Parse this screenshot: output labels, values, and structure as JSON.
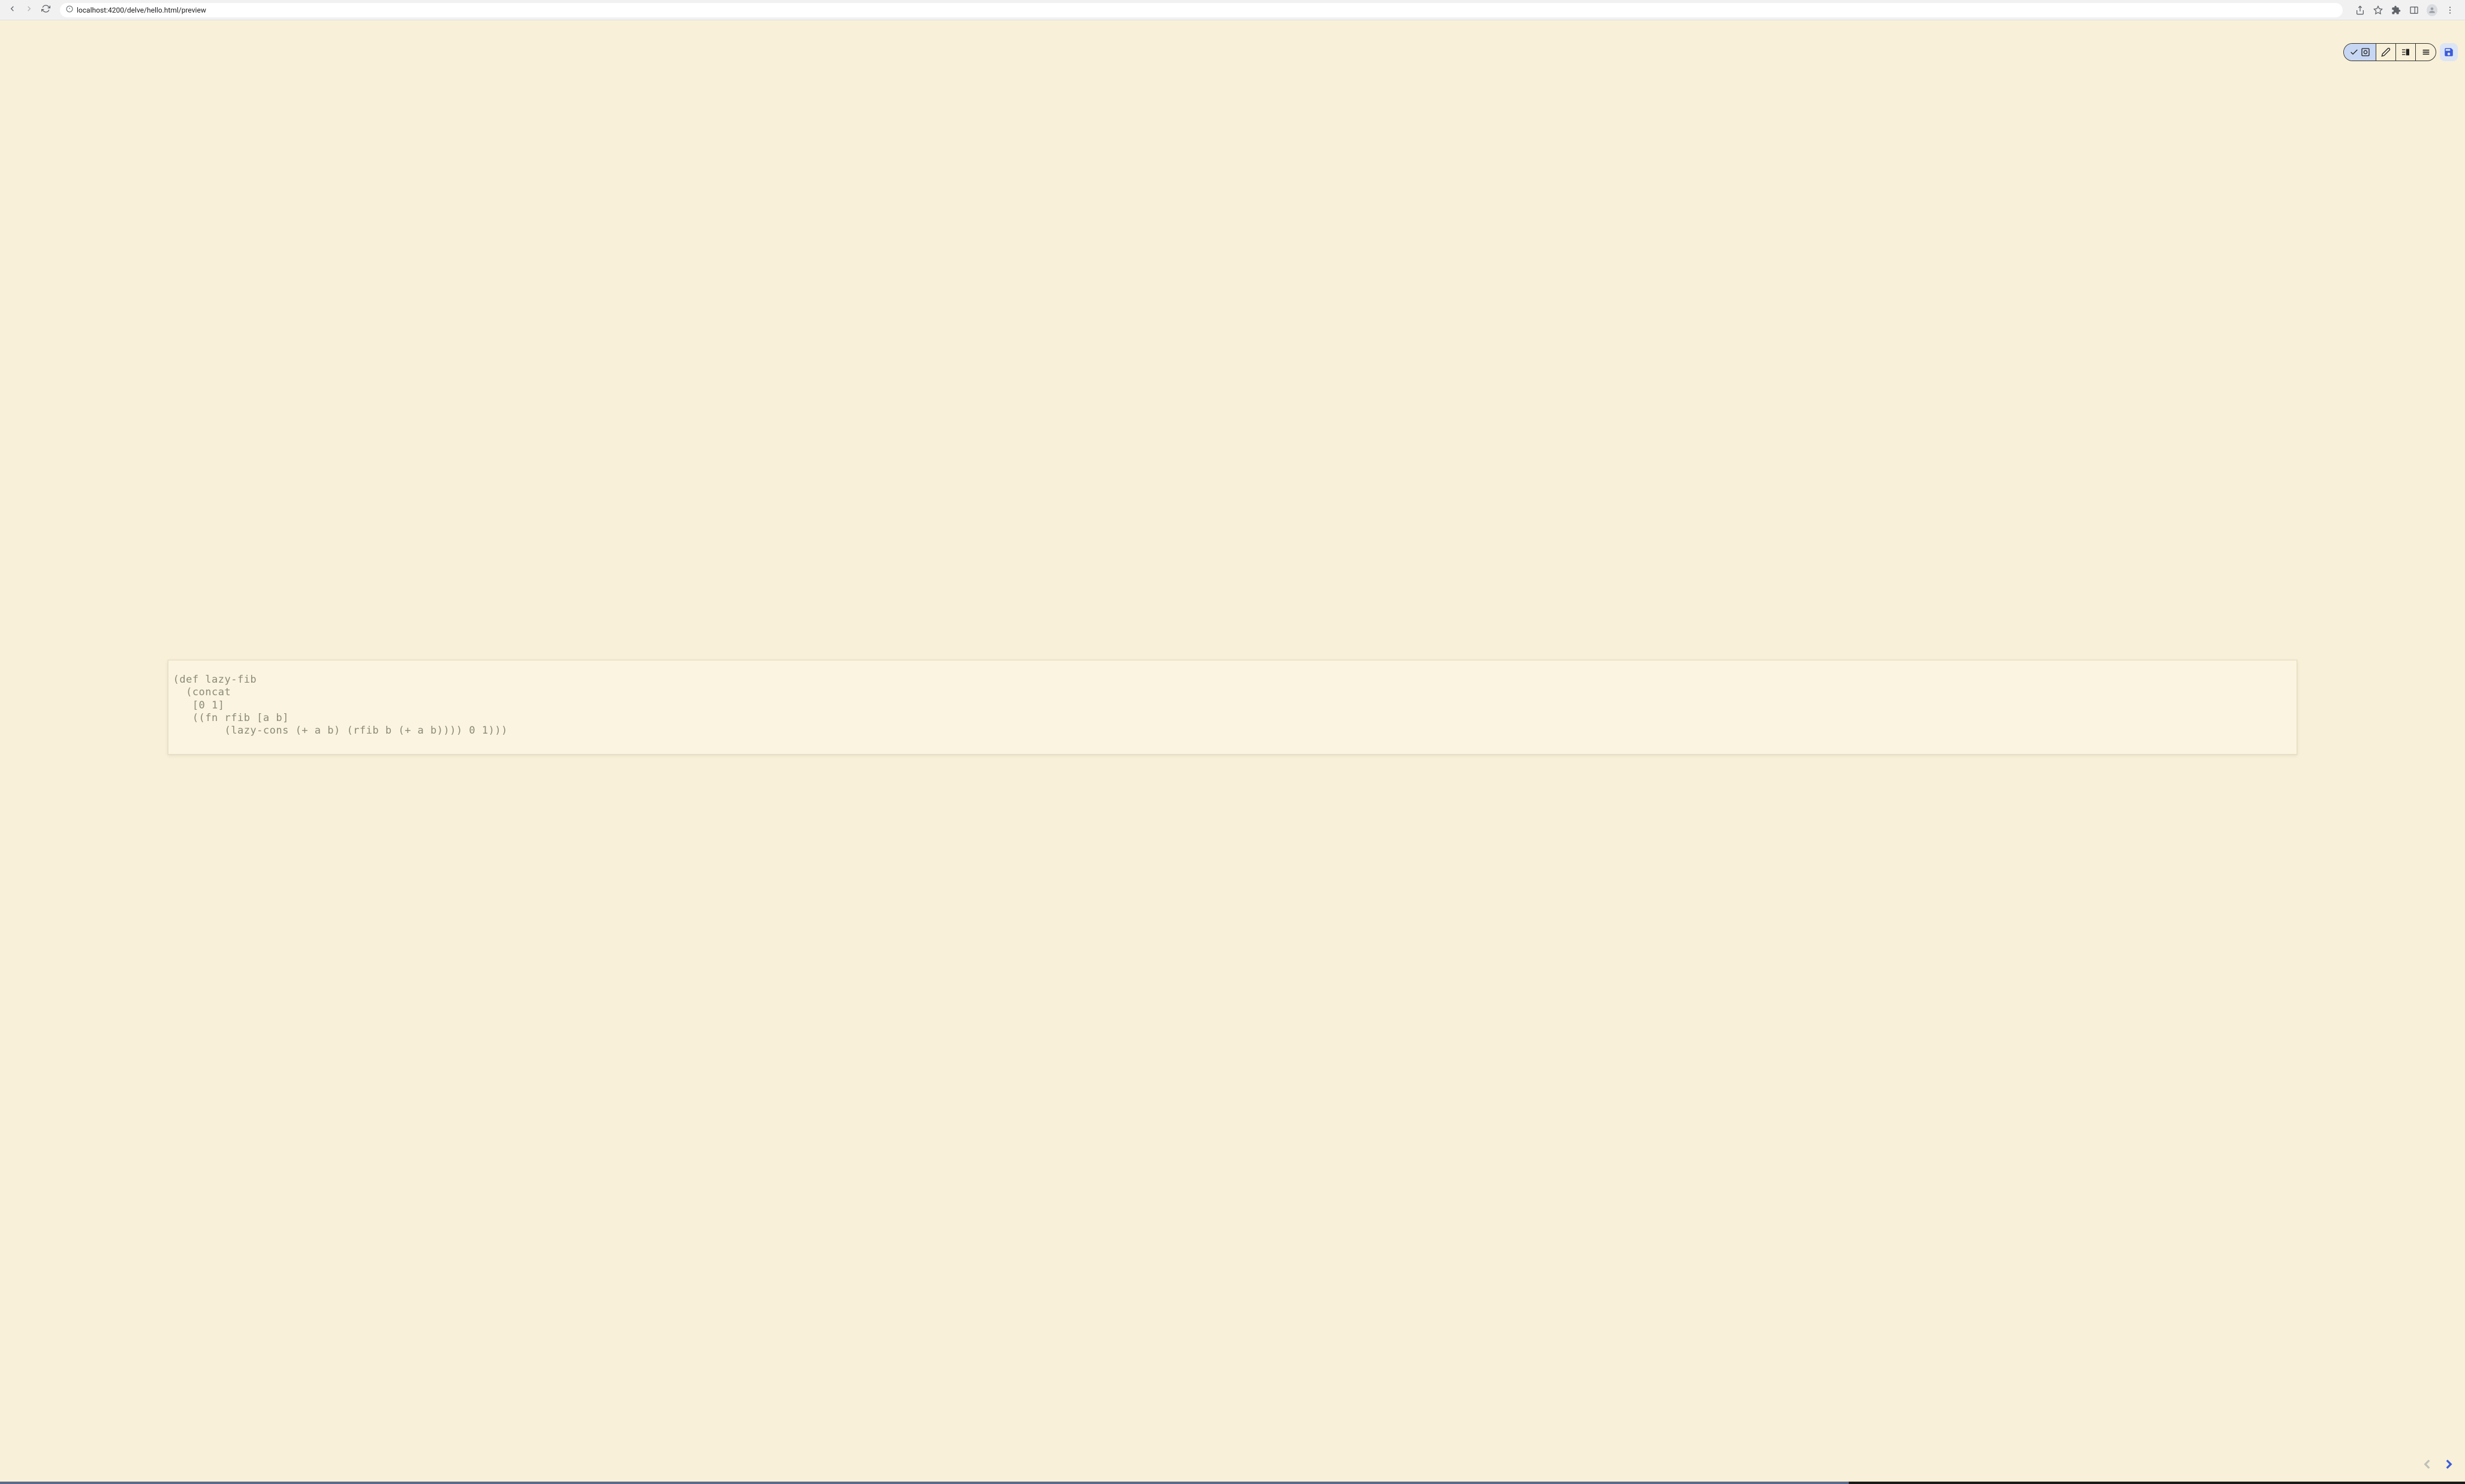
{
  "browser": {
    "url": "localhost:4200/delve/hello.html/preview"
  },
  "code": "(def lazy-fib\n  (concat\n   [0 1]\n   ((fn rfib [a b]\n        (lazy-cons (+ a b) (rfib b (+ a b)))) 0 1)))",
  "toolbar": {
    "view_mode": "preview-code"
  }
}
